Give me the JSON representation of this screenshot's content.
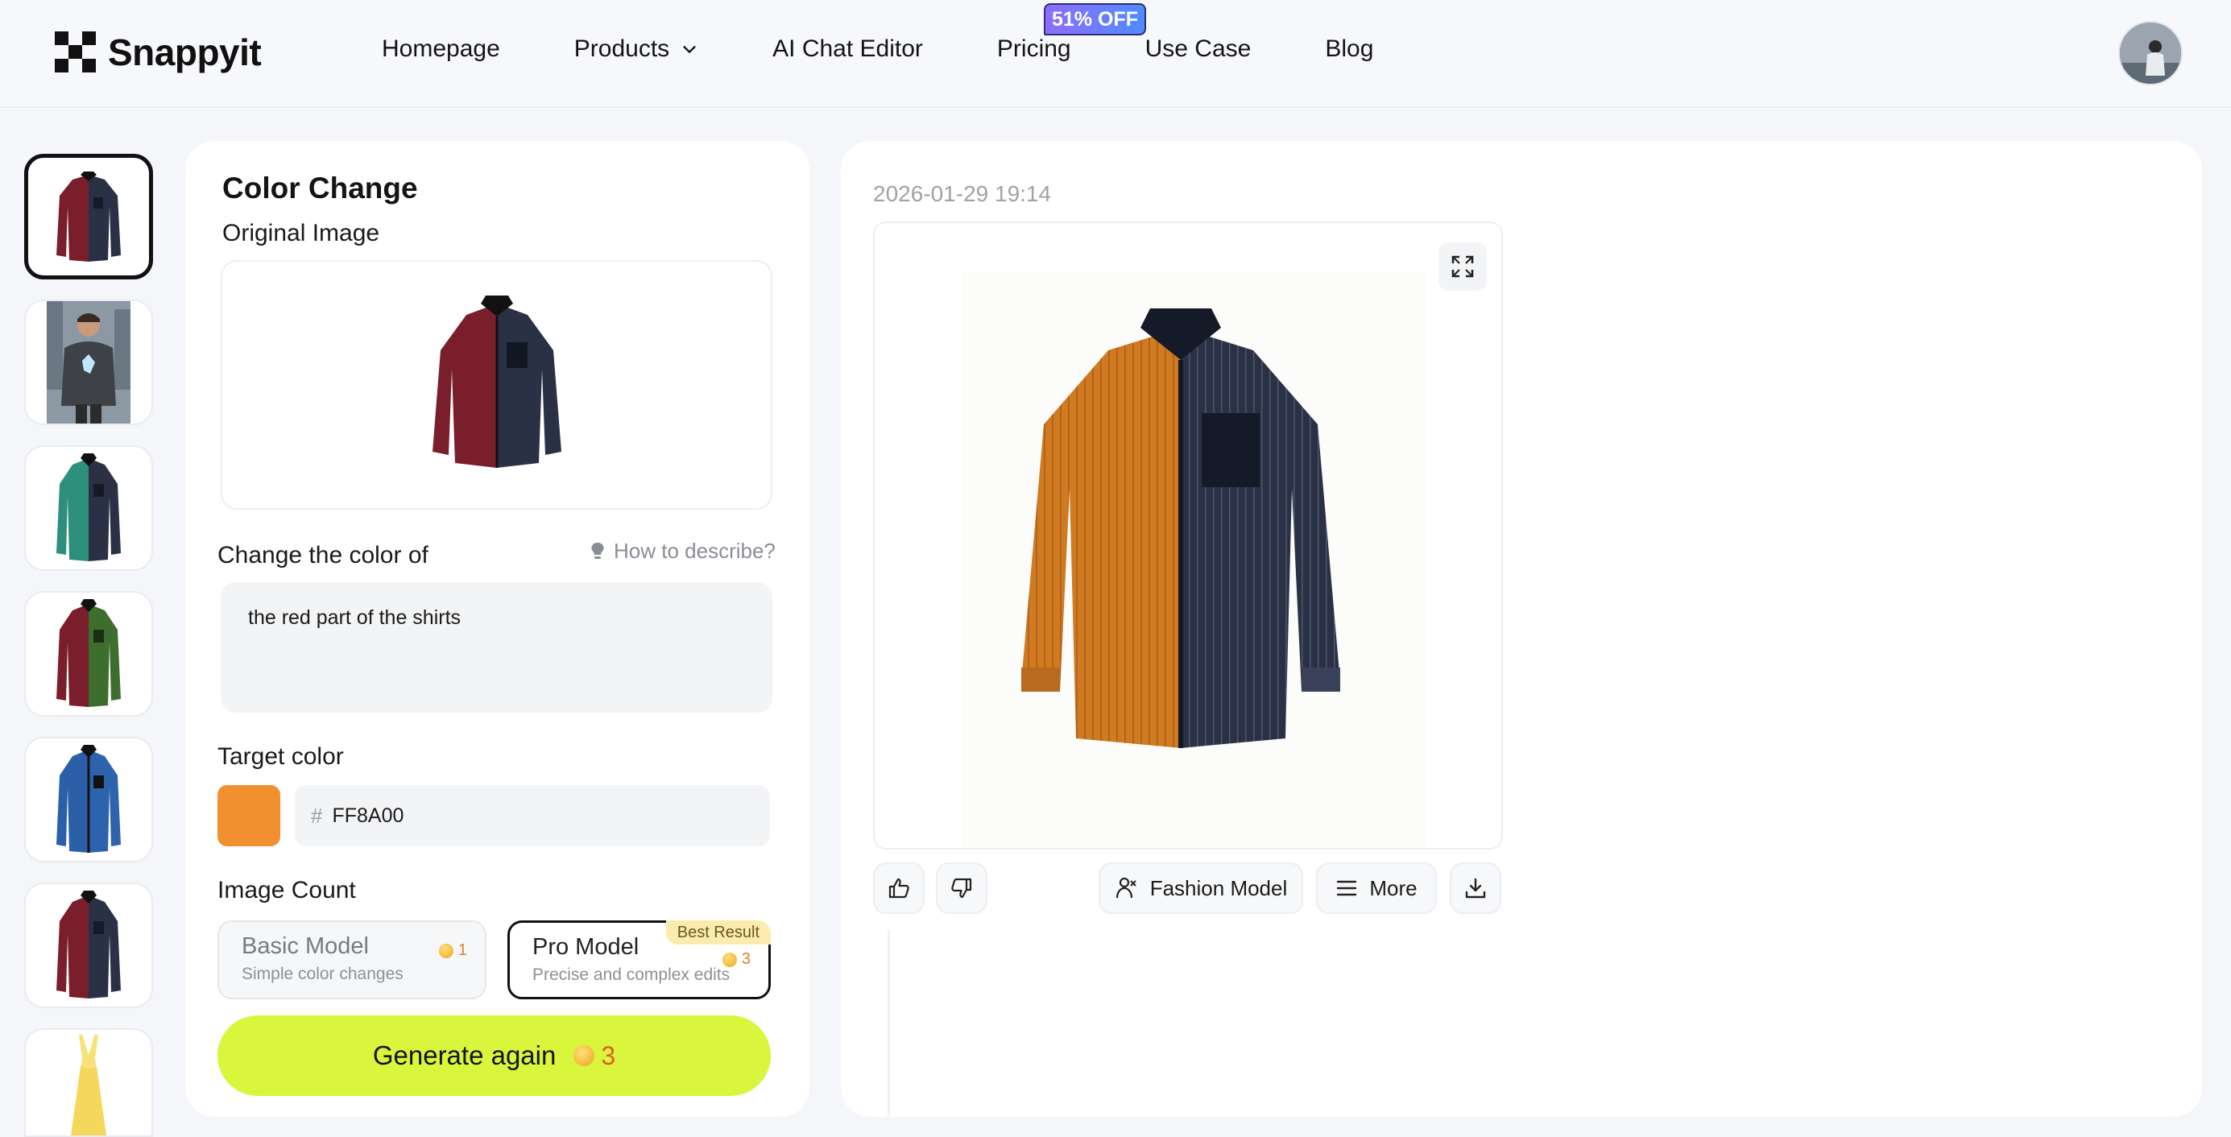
{
  "brand": {
    "name": "Snappyit"
  },
  "nav": {
    "items": [
      {
        "label": "Homepage"
      },
      {
        "label": "Products"
      },
      {
        "label": "AI Chat Editor"
      },
      {
        "label": "Pricing"
      },
      {
        "label": "Use Case"
      },
      {
        "label": "Blog"
      }
    ],
    "promo_badge": "51% OFF"
  },
  "thumbnails": [
    {
      "name": "red-navy-shirt",
      "selected": true
    },
    {
      "name": "man-hoodie"
    },
    {
      "name": "teal-navy-shirt"
    },
    {
      "name": "red-green-shirt"
    },
    {
      "name": "blue-shirt"
    },
    {
      "name": "red-navy-shirt-2"
    },
    {
      "name": "yellow-dress"
    }
  ],
  "editor": {
    "title": "Color Change",
    "original_label": "Original Image",
    "change_label": "Change the color of",
    "how_to": "How to describe?",
    "prompt_value": "the red part of the shirts",
    "target_label": "Target color",
    "target_color": "#F08A2F",
    "hex_prefix": "#",
    "hex_value": "FF8A00",
    "count_label": "Image Count",
    "models": {
      "basic": {
        "name": "Basic Model",
        "desc": "Simple color changes",
        "cost": "1"
      },
      "pro": {
        "name": "Pro Model",
        "desc": "Precise and complex edits",
        "cost": "3",
        "tag": "Best Result",
        "selected": true
      }
    },
    "generate": {
      "label": "Generate again",
      "cost": "3"
    }
  },
  "result": {
    "timestamp": "2026-01-29 19:14",
    "actions": {
      "fashion_model": "Fashion Model",
      "more": "More"
    }
  },
  "colors": {
    "accent_button": "#D9F53C",
    "shirt_left_result": "#D07A22",
    "shirt_navy": "#2A3145",
    "shirt_red": "#7A1E2C"
  }
}
